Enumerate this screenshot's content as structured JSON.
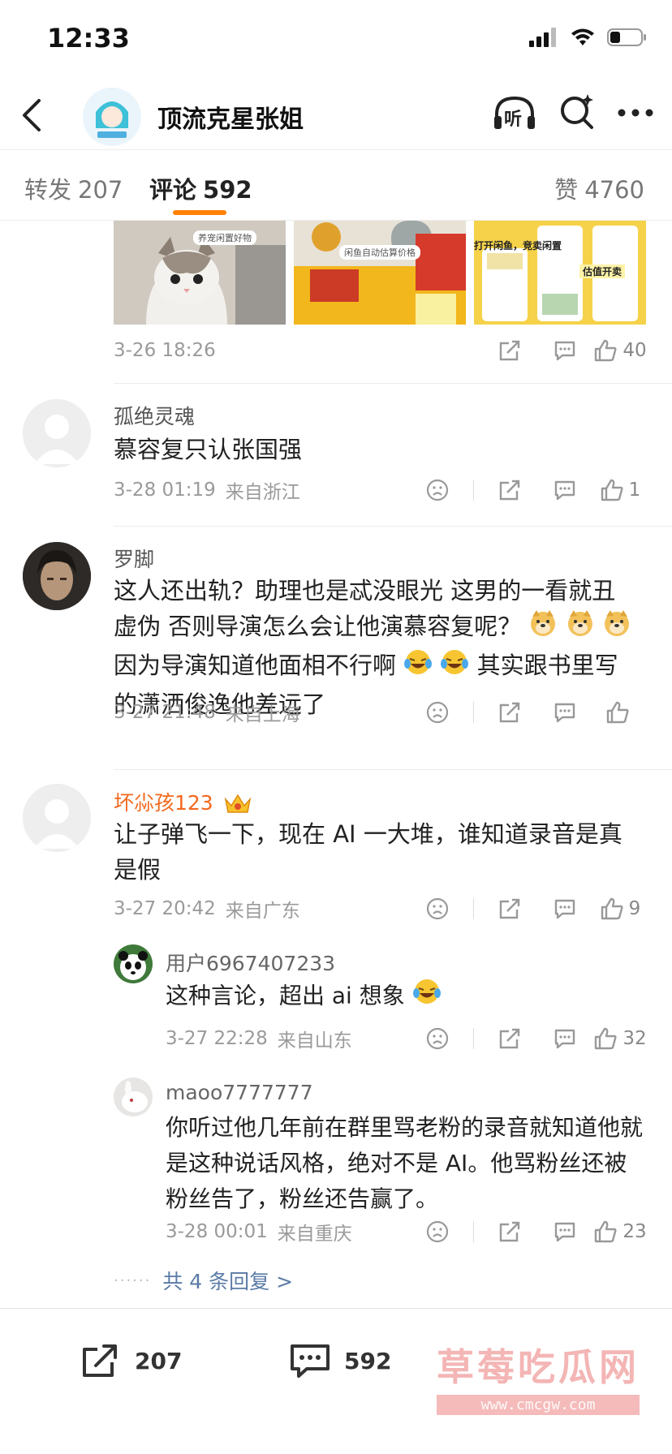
{
  "status_bar": {
    "time": "12:33"
  },
  "nav": {
    "title": "顶流克星张姐",
    "listen_label": "听"
  },
  "tabs": [
    {
      "label": "转发",
      "count": "207"
    },
    {
      "label": "评论",
      "count": "592"
    },
    {
      "label": "赞",
      "count": "4760"
    }
  ],
  "post_images": [
    {
      "caption": "养宠闲置好物"
    },
    {
      "caption": "闲鱼自动估算价格"
    },
    {
      "caption": "打开闲鱼，竞卖闲置",
      "caption2": "估值开卖"
    }
  ],
  "post_meta": {
    "time": "3-26 18:26",
    "likes": "40"
  },
  "comments": [
    {
      "name": "孤绝灵魂",
      "text": "慕容复只认张国强",
      "time": "3-28 01:19",
      "location": "来自浙江",
      "likes": "1"
    },
    {
      "name": "罗脚",
      "text_line1": "这人还出轨？助理也是忒没眼光  这男的一看就丑",
      "text_line2": "虚伪  否则导演怎么会让他演慕容复呢？",
      "text_line3": "因为导演知道他面相不行啊",
      "text_line3b": "  其实跟书里写",
      "text_line4": "的潇洒俊逸他差远了",
      "time": "3-27 21:48",
      "location": "来自上海",
      "likes": ""
    },
    {
      "name": "坏尛孩123",
      "text": "让子弹飞一下，现在 AI 一大堆，谁知道录音是真是假",
      "time": "3-27 20:42",
      "location": "来自广东",
      "likes": "9",
      "replies": [
        {
          "name": "用户6967407233",
          "text": "这种言论，超出 ai 想象",
          "time": "3-27 22:28",
          "location": "来自山东",
          "likes": "32"
        },
        {
          "name": "maoo7777777",
          "text": "你听过他几年前在群里骂老粉的录音就知道他就是这种说话风格，绝对不是 AI。他骂粉丝还被粉丝告了，粉丝还告赢了。",
          "time": "3-28 00:01",
          "location": "来自重庆",
          "likes": "23"
        }
      ],
      "more_replies": "共 4 条回复 >"
    }
  ],
  "bottom_bar": {
    "repost_count": "207",
    "comment_count": "592"
  },
  "watermark": {
    "main": "草莓吃瓜网",
    "sub": "www.cmcgw.com"
  },
  "colors": {
    "accent": "#ff8200",
    "vip_name": "#f2681e",
    "link": "#5a7ba6"
  }
}
